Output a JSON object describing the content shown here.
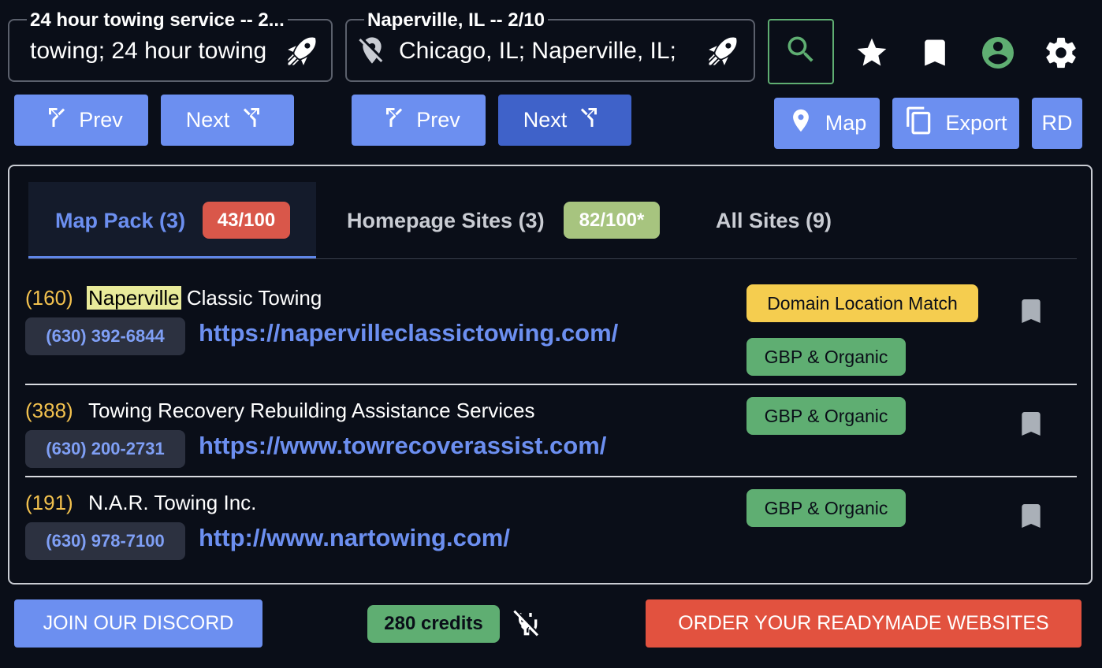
{
  "keyword_field": {
    "legend": "24 hour towing service -- 2...",
    "value": "towing; 24 hour towing"
  },
  "location_field": {
    "legend": "Naperville, IL -- 2/10",
    "value": "Chicago, IL; Naperville, IL;"
  },
  "nav": {
    "prev_label": "Prev",
    "next_label": "Next"
  },
  "actions": {
    "map_label": "Map",
    "export_label": "Export",
    "rd_label": "RD"
  },
  "tabs": [
    {
      "label": "Map Pack (3)",
      "badge": "43/100",
      "badge_color": "#d9574a",
      "active": true
    },
    {
      "label": "Homepage Sites (3)",
      "badge": "82/100*",
      "badge_color": "#a7c47f",
      "active": false
    },
    {
      "label": "All Sites (9)",
      "active": false
    }
  ],
  "results": [
    {
      "rank": "(160)",
      "name_highlight": "Naperville",
      "name_rest": " Classic Towing",
      "phone": "(630) 392-6844",
      "url": "https://napervilleclassictowing.com/",
      "tags": [
        "Domain Location Match",
        "GBP & Organic"
      ]
    },
    {
      "rank": "(388)",
      "name": "Towing Recovery Rebuilding Assistance Services",
      "phone": "(630) 200-2731",
      "url": "https://www.towrecoverassist.com/",
      "tags": [
        "GBP & Organic"
      ]
    },
    {
      "rank": "(191)",
      "name": "N.A.R. Towing Inc.",
      "phone": "(630) 978-7100",
      "url": "http://www.nartowing.com/",
      "tags": [
        "GBP & Organic"
      ]
    }
  ],
  "footer": {
    "discord_label": "JOIN OUR DISCORD",
    "credits": "280 credits",
    "order_label": "ORDER YOUR READYMADE WEBSITES"
  },
  "colors": {
    "background": "#0a0e18",
    "accent": "#6c8ff0",
    "accent_dark": "#3f62c9",
    "rank": "#f2c14e",
    "success": "#5fae72",
    "danger": "#e2523f"
  },
  "icons": [
    "rocket-icon",
    "location-off-icon",
    "search-icon",
    "star-icon",
    "bookmark-icon",
    "account-icon",
    "gear-icon",
    "merge-left-icon",
    "merge-right-icon",
    "map-pin-icon",
    "copy-icon",
    "power-plug-off-icon"
  ]
}
